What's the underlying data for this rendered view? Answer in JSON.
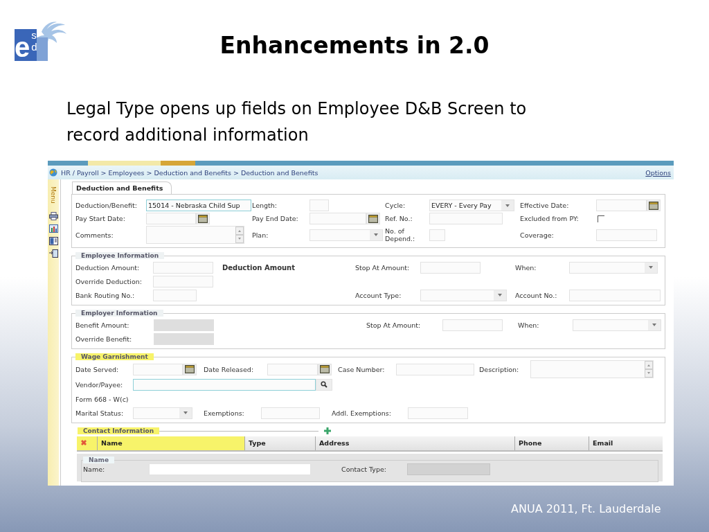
{
  "logo": {
    "letters": [
      "e",
      "s",
      "d"
    ]
  },
  "title": "Enhancements in 2.0",
  "subtitle": "Legal Type opens up fields on Employee D&B Screen to record additional information",
  "app": {
    "breadcrumb": "HR / Payroll > Employees > Deduction and Benefits > Deduction and Benefits",
    "options_link": "Options",
    "menu_label": "Menu",
    "tab": {
      "label": "Deduction and Benefits",
      "selected": true
    },
    "sections": [
      {
        "rows": [
          [
            {
              "kind": "label",
              "text": "Deduction/Benefit:"
            },
            {
              "kind": "input",
              "value": "15014 - Nebraska Child Sup",
              "focused": true
            },
            {
              "kind": "label",
              "text": "Length:"
            },
            {
              "kind": "input"
            },
            {
              "kind": "label",
              "text": "Cycle:"
            },
            {
              "kind": "select",
              "value": "EVERY - Every Pay"
            },
            {
              "kind": "label",
              "text": "Effective Date:"
            },
            {
              "kind": "date"
            }
          ],
          [
            {
              "kind": "label",
              "text": "Pay Start Date:"
            },
            {
              "kind": "date"
            },
            {
              "kind": "label",
              "text": "Pay End Date:"
            },
            {
              "kind": "date"
            },
            {
              "kind": "label",
              "text": "Ref. No.:"
            },
            {
              "kind": "input"
            },
            {
              "kind": "label",
              "text": "Excluded from PY:"
            },
            {
              "kind": "checkbox",
              "checked": false
            }
          ],
          [
            {
              "kind": "label",
              "text": "Comments:"
            },
            {
              "kind": "textarea"
            },
            {
              "kind": "label",
              "text": "Plan:"
            },
            {
              "kind": "select"
            },
            {
              "kind": "label",
              "text": "No. of Depend.:"
            },
            {
              "kind": "input"
            },
            {
              "kind": "label",
              "text": "Coverage:"
            },
            {
              "kind": "input"
            }
          ]
        ]
      },
      {
        "legend": "Employee Information",
        "highlighted": false,
        "rows": [
          [
            {
              "kind": "label",
              "text": "Deduction Amount:"
            },
            {
              "kind": "input"
            },
            {
              "kind": "heading",
              "text": "Deduction Amount"
            },
            {
              "kind": "label",
              "text": "Stop At Amount:"
            },
            {
              "kind": "input"
            },
            {
              "kind": "label",
              "text": "When:"
            },
            {
              "kind": "select"
            }
          ],
          [
            {
              "kind": "label",
              "text": "Override Deduction:"
            },
            {
              "kind": "input"
            }
          ],
          [
            {
              "kind": "label",
              "text": "Bank Routing No.:"
            },
            {
              "kind": "input"
            },
            {
              "kind": "label",
              "text": ""
            },
            {
              "kind": "label",
              "text": "Account Type:"
            },
            {
              "kind": "select"
            },
            {
              "kind": "label",
              "text": "Account No.:"
            },
            {
              "kind": "input"
            }
          ]
        ]
      },
      {
        "legend": "Employer Information",
        "highlighted": false,
        "rows": [
          [
            {
              "kind": "label",
              "text": "Benefit Amount:"
            },
            {
              "kind": "locked"
            },
            {
              "kind": "label",
              "text": "Stop At Amount:"
            },
            {
              "kind": "input"
            },
            {
              "kind": "label",
              "text": "When:"
            },
            {
              "kind": "select"
            }
          ],
          [
            {
              "kind": "label",
              "text": "Override Benefit:"
            },
            {
              "kind": "locked"
            }
          ]
        ]
      },
      {
        "legend": "Wage Garnishment",
        "highlighted": true,
        "rows": [
          [
            {
              "kind": "label",
              "text": "Date Served:"
            },
            {
              "kind": "date"
            },
            {
              "kind": "label",
              "text": "Date Released:"
            },
            {
              "kind": "date"
            },
            {
              "kind": "label",
              "text": "Case Number:"
            },
            {
              "kind": "input"
            },
            {
              "kind": "label",
              "text": "Description:"
            },
            {
              "kind": "textarea"
            }
          ],
          [
            {
              "kind": "label",
              "text": "Vendor/Payee:"
            },
            {
              "kind": "lookup",
              "focused": true
            }
          ],
          [
            {
              "kind": "label",
              "text": "Form 668 - W(c)"
            }
          ],
          [
            {
              "kind": "label",
              "text": "Marital Status:"
            },
            {
              "kind": "select"
            },
            {
              "kind": "label",
              "text": "Exemptions:"
            },
            {
              "kind": "input"
            },
            {
              "kind": "label",
              "text": "Addl. Exemptions:"
            },
            {
              "kind": "input"
            }
          ]
        ]
      }
    ],
    "contact": {
      "legend": "Contact Information",
      "highlighted": true,
      "columns": [
        "Name",
        "Type",
        "Address",
        "Phone",
        "Email"
      ],
      "group": {
        "legend": "Name",
        "fields": [
          {
            "label": "Name:"
          },
          {
            "label": "Contact Type:"
          }
        ]
      }
    }
  },
  "footer": "ANUA 2011, Ft. Lauderdale"
}
